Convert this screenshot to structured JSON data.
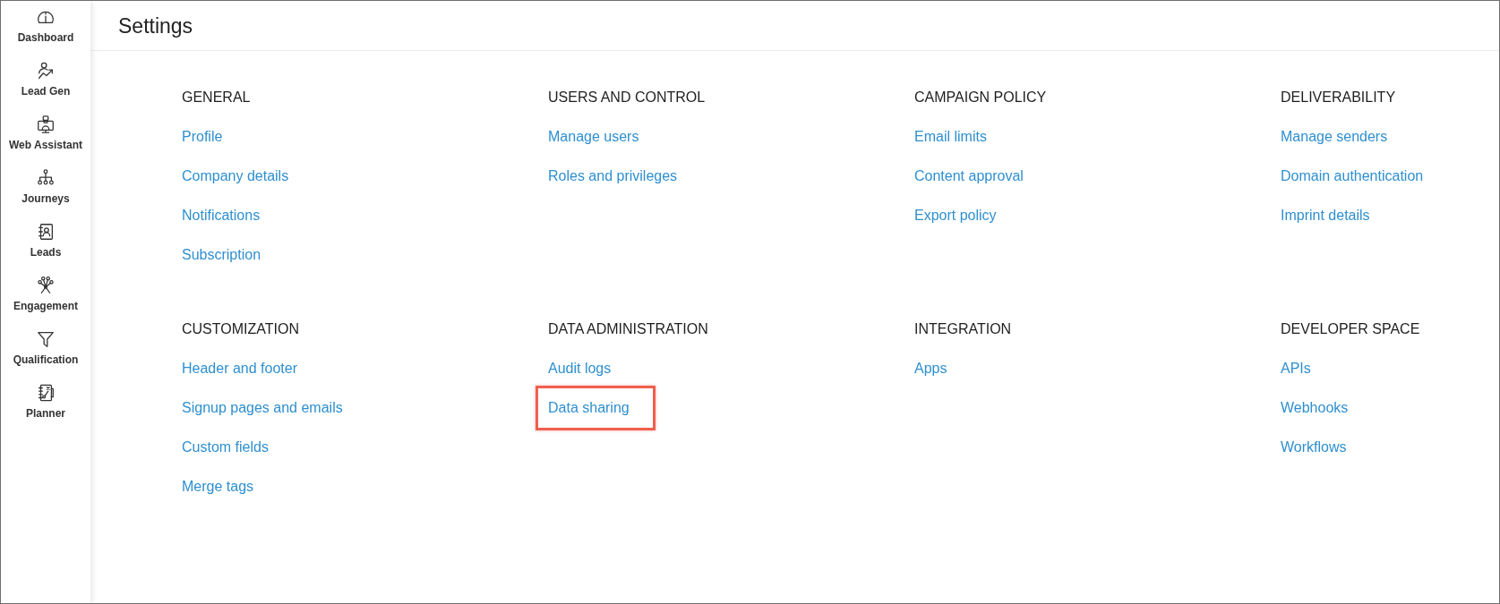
{
  "sidebar": {
    "items": [
      {
        "label": "Dashboard"
      },
      {
        "label": "Lead Gen"
      },
      {
        "label": "Web Assistant"
      },
      {
        "label": "Journeys"
      },
      {
        "label": "Leads"
      },
      {
        "label": "Engagement"
      },
      {
        "label": "Qualification"
      },
      {
        "label": "Planner"
      }
    ]
  },
  "header": {
    "title": "Settings"
  },
  "sections": [
    {
      "heading": "GENERAL",
      "links": [
        {
          "label": "Profile",
          "highlighted": false
        },
        {
          "label": "Company details",
          "highlighted": false
        },
        {
          "label": "Notifications",
          "highlighted": false
        },
        {
          "label": "Subscription",
          "highlighted": false
        }
      ]
    },
    {
      "heading": "USERS AND CONTROL",
      "links": [
        {
          "label": "Manage users",
          "highlighted": false
        },
        {
          "label": "Roles and privileges",
          "highlighted": false
        }
      ]
    },
    {
      "heading": "CAMPAIGN POLICY",
      "links": [
        {
          "label": "Email limits",
          "highlighted": false
        },
        {
          "label": "Content approval",
          "highlighted": false
        },
        {
          "label": "Export policy",
          "highlighted": false
        }
      ]
    },
    {
      "heading": "DELIVERABILITY",
      "links": [
        {
          "label": "Manage senders",
          "highlighted": false
        },
        {
          "label": "Domain authentication",
          "highlighted": false
        },
        {
          "label": "Imprint details",
          "highlighted": false
        }
      ]
    },
    {
      "heading": "CUSTOMIZATION",
      "links": [
        {
          "label": "Header and footer",
          "highlighted": false
        },
        {
          "label": "Signup pages and emails",
          "highlighted": false
        },
        {
          "label": "Custom fields",
          "highlighted": false
        },
        {
          "label": "Merge tags",
          "highlighted": false
        }
      ]
    },
    {
      "heading": "DATA ADMINISTRATION",
      "links": [
        {
          "label": "Audit logs",
          "highlighted": false
        },
        {
          "label": "Data sharing",
          "highlighted": true
        }
      ]
    },
    {
      "heading": "INTEGRATION",
      "links": [
        {
          "label": "Apps",
          "highlighted": false
        }
      ]
    },
    {
      "heading": "DEVELOPER SPACE",
      "links": [
        {
          "label": "APIs",
          "highlighted": false
        },
        {
          "label": "Webhooks",
          "highlighted": false
        },
        {
          "label": "Workflows",
          "highlighted": false
        }
      ]
    }
  ]
}
